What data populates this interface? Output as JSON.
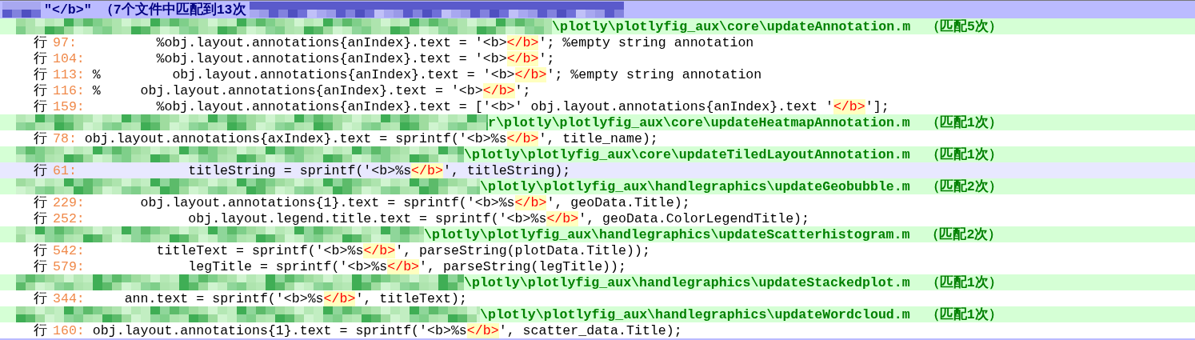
{
  "search_header": {
    "text": "\"</b>\" （7个文件中匹配到13次"
  },
  "files": [
    {
      "path": "\\plotly\\plotlyfig_aux\\core\\updateAnnotation.m",
      "count": "（匹配5次）",
      "lines": [
        {
          "label": "行",
          "number": "97:",
          "code_before": "          %obj.layout.annotations{anIndex}.text = '<b>",
          "match": "</b>",
          "code_after": "'; %empty string annotation",
          "selected": false
        },
        {
          "label": "行",
          "number": "104:",
          "code_before": "         %obj.layout.annotations{anIndex}.text = '<b>",
          "match": "</b>",
          "code_after": "';",
          "selected": false
        },
        {
          "label": "行",
          "number": "113:",
          "code_before": " %         obj.layout.annotations{anIndex}.text = '<b>",
          "match": "</b>",
          "code_after": "'; %empty string annotation",
          "selected": false
        },
        {
          "label": "行",
          "number": "116:",
          "code_before": " %     obj.layout.annotations{anIndex}.text = '<b>",
          "match": "</b>",
          "code_after": "';",
          "selected": false
        },
        {
          "label": "行",
          "number": "159:",
          "code_before": "         %obj.layout.annotations{anIndex}.text = ['<b>' obj.layout.annotations{anIndex}.text '",
          "match": "</b>",
          "code_after": "'];",
          "selected": false
        }
      ]
    },
    {
      "path": "r\\plotly\\plotlyfig_aux\\core\\updateHeatmapAnnotation.m",
      "count": "（匹配1次）",
      "lines": [
        {
          "label": "行",
          "number": "78:",
          "code_before": " obj.layout.annotations{axIndex}.text = sprintf('<b>%s",
          "match": "</b>",
          "code_after": "', title_name);",
          "selected": false
        }
      ]
    },
    {
      "path": "\\plotly\\plotlyfig_aux\\core\\updateTiledLayoutAnnotation.m",
      "count": "（匹配1次）",
      "lines": [
        {
          "label": "行",
          "number": "61:",
          "code_before": "              titleString = sprintf('<b>%s",
          "match": "</b>",
          "code_after": "', titleString);",
          "selected": true
        }
      ]
    },
    {
      "path": "\\plotly\\plotlyfig_aux\\handlegraphics\\updateGeobubble.m",
      "count": "（匹配2次）",
      "lines": [
        {
          "label": "行",
          "number": "229:",
          "code_before": "       obj.layout.annotations{1}.text = sprintf('<b>%s",
          "match": "</b>",
          "code_after": "', geoData.Title);",
          "selected": false
        },
        {
          "label": "行",
          "number": "252:",
          "code_before": "             obj.layout.legend.title.text = sprintf('<b>%s",
          "match": "</b>",
          "code_after": "', geoData.ColorLegendTitle);",
          "selected": false
        }
      ]
    },
    {
      "path": "\\plotly\\plotlyfig_aux\\handlegraphics\\updateScatterhistogram.m",
      "count": "（匹配2次）",
      "lines": [
        {
          "label": "行",
          "number": "542:",
          "code_before": "         titleText = sprintf('<b>%s",
          "match": "</b>",
          "code_after": "', parseString(plotData.Title));",
          "selected": false
        },
        {
          "label": "行",
          "number": "579:",
          "code_before": "             legTitle = sprintf('<b>%s",
          "match": "</b>",
          "code_after": "', parseString(legTitle));",
          "selected": false
        }
      ]
    },
    {
      "path": "\\plotly\\plotlyfig_aux\\handlegraphics\\updateStackedplot.m",
      "count": "（匹配1次）",
      "lines": [
        {
          "label": "行",
          "number": "344:",
          "code_before": "     ann.text = sprintf('<b>%s",
          "match": "</b>",
          "code_after": "', titleText);",
          "selected": false
        }
      ]
    },
    {
      "path": "\\plotly\\plotlyfig_aux\\handlegraphics\\updateWordcloud.m",
      "count": "（匹配1次）",
      "lines": [
        {
          "label": "行",
          "number": "160:",
          "code_before": " obj.layout.annotations{1}.text = sprintf('<b>%s",
          "match": "</b>",
          "code_after": "', scatter_data.Title);",
          "selected": false
        }
      ]
    }
  ]
}
